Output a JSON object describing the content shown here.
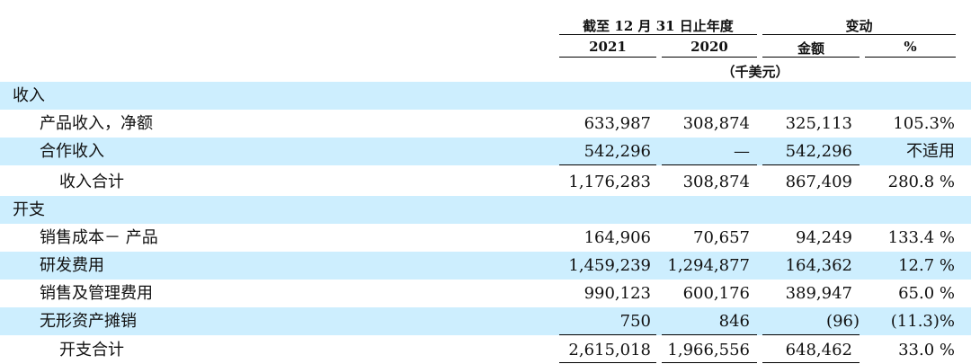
{
  "header": {
    "period_title": "截至 12 月 31 日止年度",
    "change_title": "变动",
    "col_2021": "2021",
    "col_2020": "2020",
    "col_amount": "金额",
    "col_pct": "%",
    "unit": "（千美元）"
  },
  "rows": [
    {
      "label": "收入",
      "v2021": "",
      "v2020": "",
      "amount": "",
      "pct": ""
    },
    {
      "label": "产品收入，净额",
      "v2021": "633,987",
      "v2020": "308,874",
      "amount": "325,113",
      "pct": "105.3%"
    },
    {
      "label": "合作收入",
      "v2021": "542,296",
      "v2020": "—",
      "amount": "542,296",
      "pct": "不适用"
    },
    {
      "label": "收入合计",
      "v2021": "1,176,283",
      "v2020": "308,874",
      "amount": "867,409",
      "pct": "280.8 %"
    },
    {
      "label": "开支",
      "v2021": "",
      "v2020": "",
      "amount": "",
      "pct": ""
    },
    {
      "label": "销售成本－ 产品",
      "v2021": "164,906",
      "v2020": "70,657",
      "amount": "94,249",
      "pct": "133.4 %"
    },
    {
      "label": "研发费用",
      "v2021": "1,459,239",
      "v2020": "1,294,877",
      "amount": "164,362",
      "pct": "12.7 %"
    },
    {
      "label": "销售及管理费用",
      "v2021": "990,123",
      "v2020": "600,176",
      "amount": "389,947",
      "pct": "65.0 %"
    },
    {
      "label": "无形资产摊销",
      "v2021": "750",
      "v2020": "846",
      "amount": "(96)",
      "pct": "(11.3)%"
    },
    {
      "label": "开支合计",
      "v2021": "2,615,018",
      "v2020": "1,966,556",
      "amount": "648,462",
      "pct": "33.0 %"
    }
  ],
  "colors": {
    "row_shade": "#cdeefe",
    "text": "#111111",
    "rule": "#000000"
  }
}
